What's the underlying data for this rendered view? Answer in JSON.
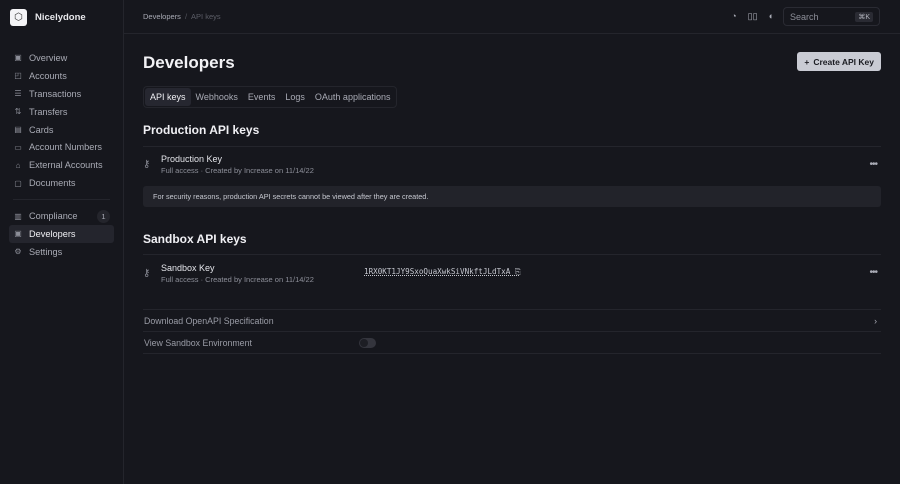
{
  "brand": {
    "name": "Nicelydone"
  },
  "sidebar": {
    "items": [
      {
        "label": "Overview",
        "icon": "chart-icon"
      },
      {
        "label": "Accounts",
        "icon": "wallet-icon"
      },
      {
        "label": "Transactions",
        "icon": "list-icon"
      },
      {
        "label": "Transfers",
        "icon": "arrows-icon"
      },
      {
        "label": "Cards",
        "icon": "card-icon"
      },
      {
        "label": "Account Numbers",
        "icon": "number-icon"
      },
      {
        "label": "External Accounts",
        "icon": "bank-icon"
      },
      {
        "label": "Documents",
        "icon": "folder-icon"
      }
    ],
    "secondary": [
      {
        "label": "Compliance",
        "badge": "1"
      },
      {
        "label": "Developers"
      },
      {
        "label": "Settings"
      }
    ]
  },
  "breadcrumb": {
    "parent": "Developers",
    "current": "API keys"
  },
  "search": {
    "placeholder": "Search",
    "shortcut": "⌘K"
  },
  "page": {
    "title": "Developers",
    "create_label": "Create API Key"
  },
  "tabs": [
    "API keys",
    "Webhooks",
    "Events",
    "Logs",
    "OAuth applications"
  ],
  "production": {
    "title": "Production API keys",
    "key_name": "Production Key",
    "key_sub": "Full access · Created by Increase on 11/14/22",
    "notice": "For security reasons, production API secrets cannot be viewed after they are created."
  },
  "sandbox": {
    "title": "Sandbox API keys",
    "key_name": "Sandbox Key",
    "key_sub": "Full access · Created by Increase on 11/14/22",
    "secret": "1RX0KT1JY9SxoQuaXwkSiVNkftJLdTxA"
  },
  "links": {
    "download": "Download OpenAPI Specification",
    "sandbox_env": "View Sandbox Environment",
    "sandbox_env_on": false
  }
}
